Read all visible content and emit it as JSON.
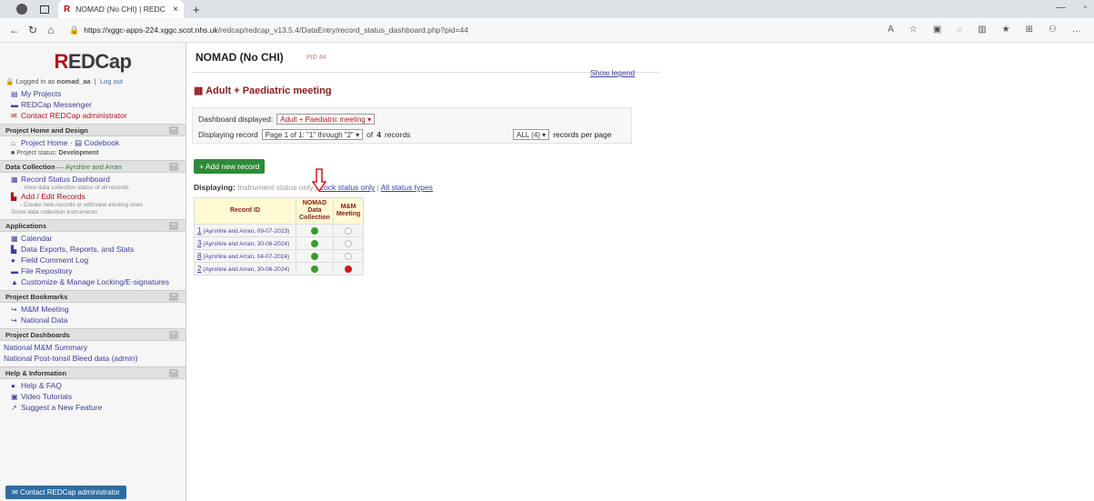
{
  "browser": {
    "tab_title": "NOMAD (No CHI) | REDCap",
    "tab_close": "×",
    "new_tab": "+",
    "url_host": "https://xggc-apps-224.xggc.scot.nhs.uk",
    "url_path": "/redcap/redcap_v13.5.4/DataEntry/record_status_dashboard.php?pid=44"
  },
  "sidebar": {
    "logo_red": "R",
    "logo_rest": "EDCap",
    "logged_in_prefix": "Logged in as ",
    "username": "nomad_aa",
    "logout": "Log out",
    "top_links": [
      {
        "label": "My Projects"
      },
      {
        "label": "REDCap Messenger"
      },
      {
        "label": "Contact REDCap administrator"
      }
    ],
    "home_design": {
      "head": "Project Home and Design",
      "project_home": "Project Home",
      "sep": "·",
      "codebook": "Codebook",
      "status_label": "Project status:",
      "status_value": "Development"
    },
    "data_collection": {
      "head": "Data Collection",
      "arm": "— Ayrshire and Arran",
      "record_status": "Record Status Dashboard",
      "record_status_sub": "- View data collection status of all records",
      "add_edit": "Add / Edit Records",
      "add_edit_sub": "- Create new records or edit/view existing ones",
      "show_instruments": "Show data collection instruments"
    },
    "applications": {
      "head": "Applications",
      "items": [
        "Calendar",
        "Data Exports, Reports, and Stats",
        "Field Comment Log",
        "File Repository",
        "Customize & Manage Locking/E-signatures"
      ]
    },
    "bookmarks": {
      "head": "Project Bookmarks",
      "items": [
        "M&M Meeting",
        "National Data"
      ]
    },
    "dashboards": {
      "head": "Project Dashboards",
      "items": [
        "National M&M Summary",
        "National Post-tonsil Bleed data (admin)"
      ]
    },
    "help": {
      "head": "Help & Information",
      "items": [
        "Help & FAQ",
        "Video Tutorials",
        "Suggest a New Feature"
      ]
    },
    "contact_button": "Contact REDCap administrator"
  },
  "main": {
    "project_title": "NOMAD (No CHI)",
    "pid": "PID 44",
    "meeting_title": "Adult + Paediatric meeting",
    "show_legend": "Show legend",
    "dashboard_label": "Dashboard displayed:",
    "dashboard_value": "Adult + Paediatric meeting",
    "displaying_record_label": "Displaying record",
    "page_select": "Page 1 of 1: \"1\" through \"2\"",
    "of_label": "of",
    "record_count": "4",
    "records_word": "records",
    "per_page_value": "ALL (4)",
    "per_page_label": "records per page",
    "add_new_record": "+ Add new record",
    "displaying_label": "Displaying:",
    "instrument_status_only": "Instrument status only",
    "sep": "|",
    "lock_status_only": "Lock status only",
    "all_status_types": "All status types",
    "table": {
      "col_record": "Record ID",
      "col_nomad_line1": "NOMAD",
      "col_nomad_line2": "Data",
      "col_nomad_line3": "Collection",
      "col_mm_line1": "M&M",
      "col_mm_line2": "Meeting",
      "rows": [
        {
          "num": "1",
          "detail": "(Ayrshire and Arran, 09-07-2023)",
          "nomad": "green",
          "mm": "gray"
        },
        {
          "num": "3",
          "detail": "(Ayrshire and Arran, 30-06-2024)",
          "nomad": "green",
          "mm": "gray"
        },
        {
          "num": "8",
          "detail": "(Ayrshire and Arran, 04-07-2024)",
          "nomad": "green",
          "mm": "gray"
        },
        {
          "num": "2",
          "detail": "(Ayrshire and Arran, 30-06-2024)",
          "nomad": "green",
          "mm": "red"
        }
      ]
    }
  }
}
